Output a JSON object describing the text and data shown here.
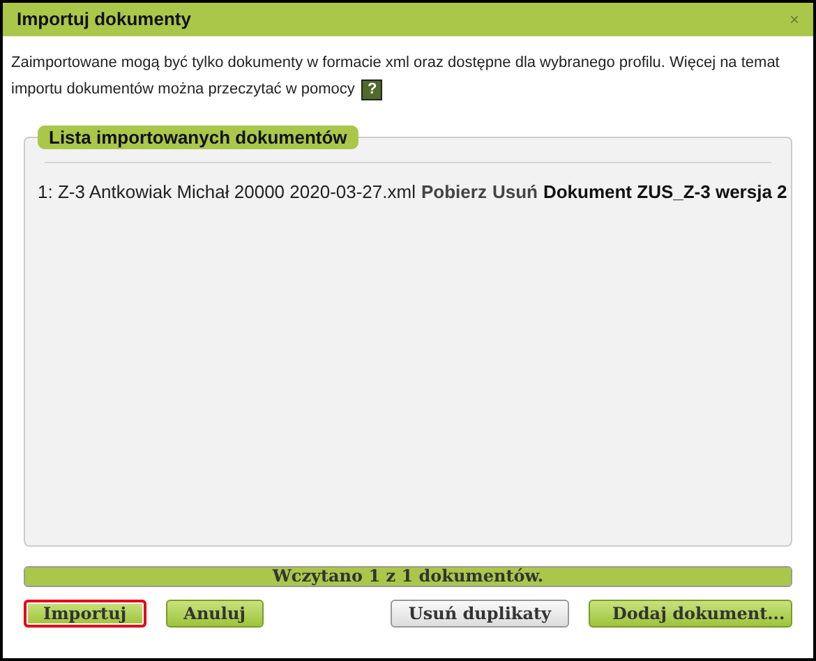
{
  "window": {
    "title": "Importuj dokumenty",
    "close": "×"
  },
  "intro": {
    "lines": [
      "Zaimportowane mogą być tylko dokumenty w formacie xml oraz dostępne dla wybranego profilu. Więcej na temat",
      "importu dokumentów można przeczytać w pomocy"
    ],
    "help": "?"
  },
  "list": {
    "legend": "Lista importowanych dokumentów",
    "rows": [
      {
        "file": "1: Z-3 Antkowiak Michał 20000 2020-03-27.xml",
        "download": "Pobierz",
        "remove": "Usuń",
        "description": "Dokument ZUS_Z-3 wersja 2"
      }
    ]
  },
  "progress": {
    "text": "Wczytano 1 z 1 dokumentów.",
    "level": 1
  },
  "buttons": [
    {
      "label": "Importuj",
      "kind": "primary",
      "focused": true
    },
    {
      "label": "Anuluj",
      "kind": "primary",
      "focused": false
    },
    {
      "label": "Usuń duplikaty",
      "kind": "secondary",
      "focused": false
    },
    {
      "label": "Dodaj dokument...",
      "kind": "wide",
      "focused": false
    }
  ]
}
